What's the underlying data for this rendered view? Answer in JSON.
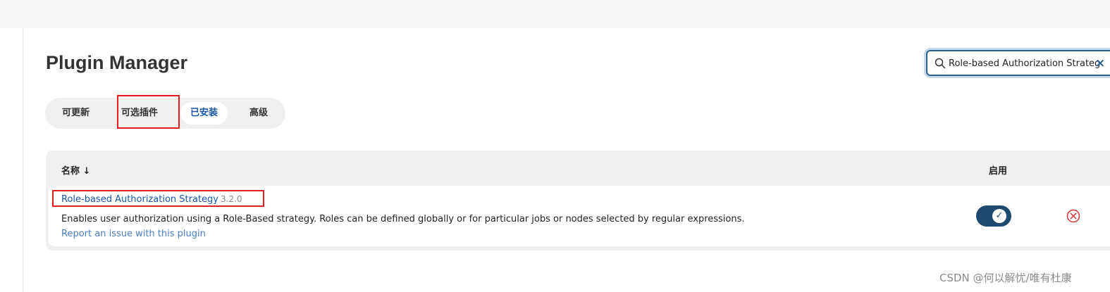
{
  "page": {
    "title": "Plugin Manager",
    "search": {
      "value": "Role-based Authorization Strategy",
      "placeholder": ""
    }
  },
  "tabs": [
    {
      "label": "可更新"
    },
    {
      "label": "可选插件"
    },
    {
      "label": "已安装",
      "active": true
    },
    {
      "label": "高级"
    }
  ],
  "table": {
    "columns": {
      "name": "名称 ↓",
      "enabled": "启用"
    },
    "rows": [
      {
        "name": "Role-based Authorization Strategy",
        "version": "3.2.0",
        "description": "Enables user authorization using a Role-Based strategy. Roles can be defined globally or for particular jobs or nodes selected by regular expressions.",
        "report_link": "Report an issue with this plugin",
        "enabled": true
      }
    ]
  },
  "watermark": "CSDN @何以解忧/唯有杜康",
  "colors": {
    "accent": "#1a56a7",
    "toggle": "#1f4a6e",
    "highlight": "#e02020",
    "remove": "#d93030"
  },
  "icons": {
    "search": "search-icon",
    "clear": "clear-icon",
    "check": "check-icon",
    "remove": "remove-circle-icon"
  }
}
